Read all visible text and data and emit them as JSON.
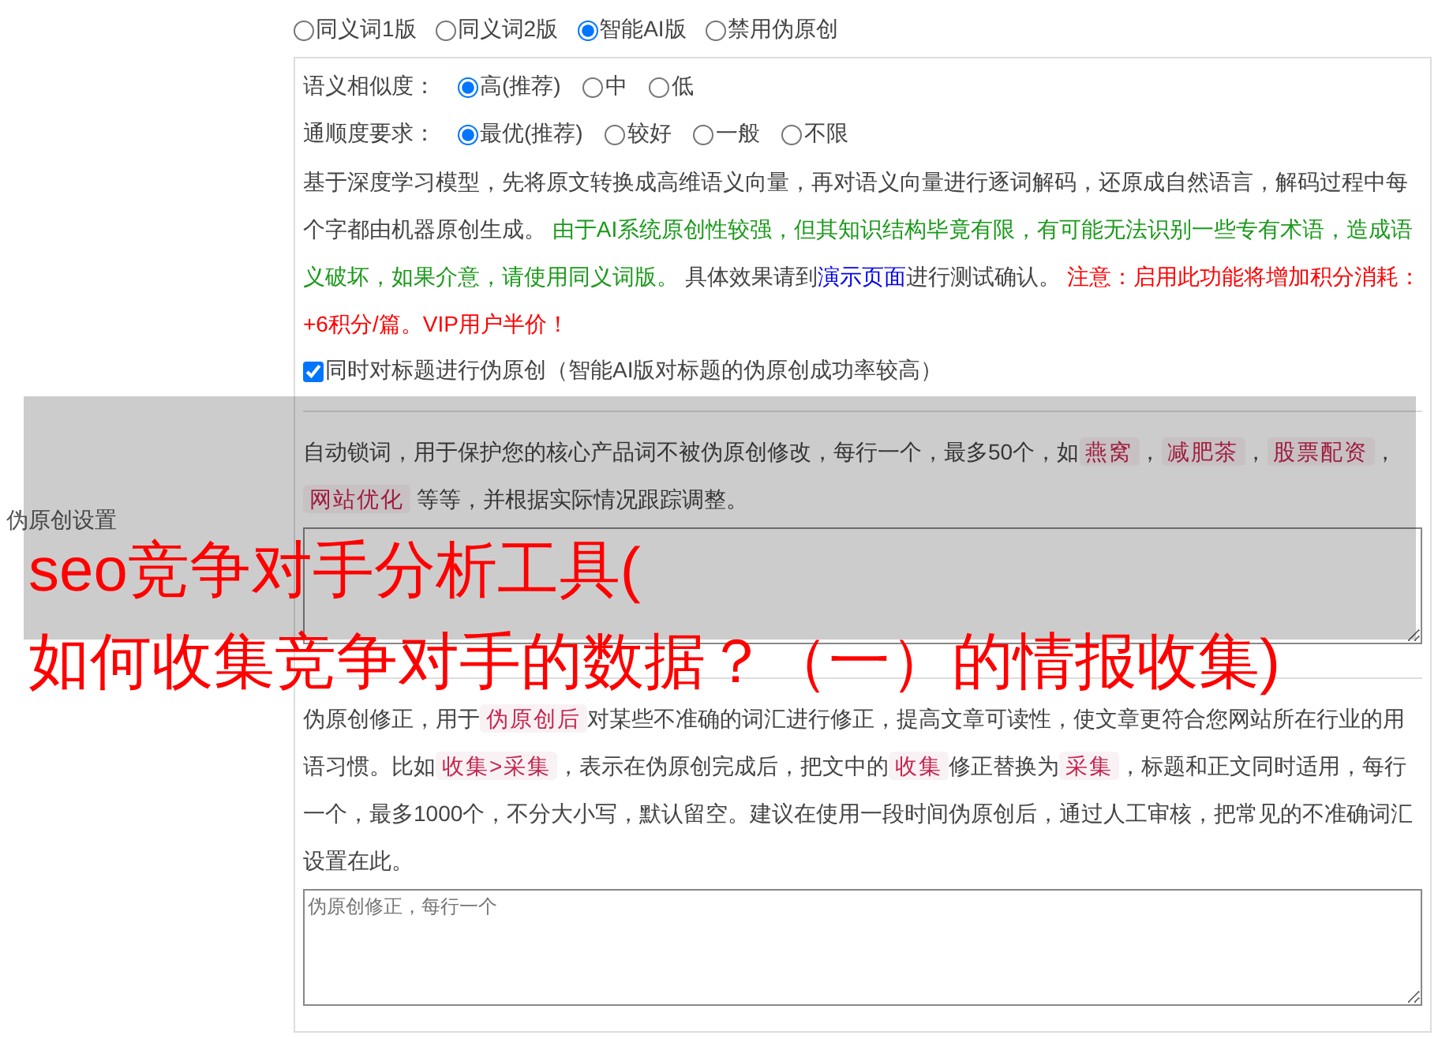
{
  "section_label": "伪原创设置",
  "modes": [
    {
      "label": "同义词1版",
      "selected": false
    },
    {
      "label": "同义词2版",
      "selected": false
    },
    {
      "label": "智能AI版",
      "selected": true
    },
    {
      "label": "禁用伪原创",
      "selected": false
    }
  ],
  "similarity": {
    "label": "语义相似度：",
    "options": [
      {
        "label": "高(推荐)",
        "selected": true
      },
      {
        "label": "中",
        "selected": false
      },
      {
        "label": "低",
        "selected": false
      }
    ]
  },
  "fluency": {
    "label": "通顺度要求：",
    "options": [
      {
        "label": "最优(推荐)",
        "selected": true
      },
      {
        "label": "较好",
        "selected": false
      },
      {
        "label": "一般",
        "selected": false
      },
      {
        "label": "不限",
        "selected": false
      }
    ]
  },
  "ai_description": [
    {
      "kind": "text",
      "text": "基于深度学习模型，先将原文转换成高维语义向量，再对语义向量进行逐词解码，还原成自然语言，解码过程中每个字都由机器原创生成。 "
    },
    {
      "kind": "green",
      "text": "由于AI系统原创性较强，但其知识结构毕竟有限，有可能无法识别一些专有术语，造成语义破坏，如果介意，请使用同义词版。"
    },
    {
      "kind": "text",
      "text": " 具体效果请到"
    },
    {
      "kind": "link",
      "text": "演示页面"
    },
    {
      "kind": "text",
      "text": "进行测试确认。 "
    },
    {
      "kind": "red",
      "text": "注意：启用此功能将增加积分消耗：+6积分/篇。VIP用户半价！"
    }
  ],
  "title_checkbox": {
    "label": "同时对标题进行伪原创（智能AI版对标题的伪原创成功率较高）",
    "checked": true
  },
  "lock_words": {
    "description": [
      {
        "kind": "text",
        "text": "自动锁词，用于保护您的核心产品词不被伪原创修改，每行一个，最多50个，如"
      },
      {
        "kind": "code",
        "text": "燕窝"
      },
      {
        "kind": "text",
        "text": "，"
      },
      {
        "kind": "code",
        "text": "减肥茶"
      },
      {
        "kind": "text",
        "text": "，"
      },
      {
        "kind": "code",
        "text": "股票配资"
      },
      {
        "kind": "text",
        "text": "，"
      },
      {
        "kind": "code",
        "text": "网站优化"
      },
      {
        "kind": "text",
        "text": " 等等，并根据实际情况跟踪调整。"
      }
    ]
  },
  "corrections": {
    "description": [
      {
        "kind": "text",
        "text": "伪原创修正，用于"
      },
      {
        "kind": "code",
        "text": "伪原创后"
      },
      {
        "kind": "text",
        "text": "对某些不准确的词汇进行修正，提高文章可读性，使文章更符合您网站所在行业的用语习惯。比如"
      },
      {
        "kind": "code",
        "text": "收集>采集"
      },
      {
        "kind": "text",
        "text": "，表示在伪原创完成后，把文中的"
      },
      {
        "kind": "code",
        "text": "收集"
      },
      {
        "kind": "text",
        "text": "修正替换为"
      },
      {
        "kind": "code",
        "text": "采集"
      },
      {
        "kind": "text",
        "text": "，标题和正文同时适用，每行一个，最多1000个，不分大小写，默认留空。建议在使用一段时间伪原创后，通过人工审核，把常见的不准确词汇设置在此。"
      }
    ],
    "placeholder": "伪原创修正，每行一个"
  },
  "overlay_title": [
    "seo竞争对手分析工具(",
    "如何收集竞争对手的数据？（一）的情报收集)"
  ]
}
